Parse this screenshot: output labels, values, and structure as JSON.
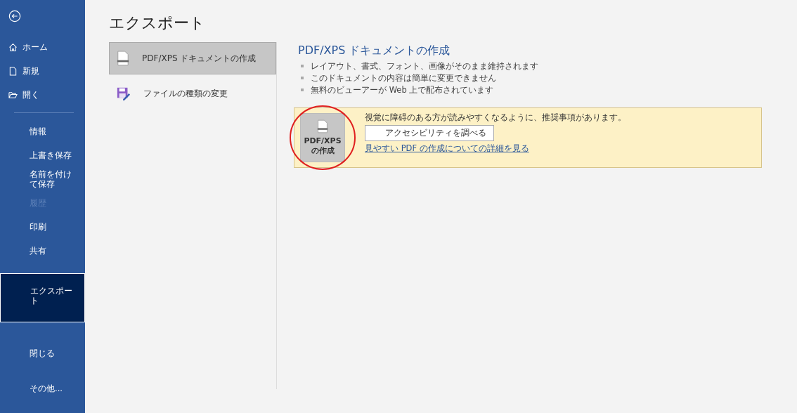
{
  "sidebar": {
    "top_items": [
      {
        "label": "ホーム"
      },
      {
        "label": "新規"
      },
      {
        "label": "開く"
      }
    ],
    "items": [
      {
        "label": "情報",
        "selected": false,
        "disabled": false
      },
      {
        "label": "上書き保存",
        "selected": false,
        "disabled": false
      },
      {
        "label": "名前を付けて保存",
        "selected": false,
        "disabled": false
      },
      {
        "label": "履歴",
        "selected": false,
        "disabled": true
      },
      {
        "label": "印刷",
        "selected": false,
        "disabled": false
      },
      {
        "label": "共有",
        "selected": false,
        "disabled": false
      },
      {
        "label": "エクスポート",
        "selected": true,
        "disabled": false
      }
    ],
    "bottom_items": [
      {
        "label": "閉じる"
      },
      {
        "label": "その他..."
      }
    ]
  },
  "page_title": "エクスポート",
  "export_options": [
    {
      "label": "PDF/XPS ドキュメントの作成",
      "selected": true
    },
    {
      "label": "ファイルの種類の変更",
      "selected": false
    }
  ],
  "detail": {
    "title": "PDF/XPS ドキュメントの作成",
    "bullets": [
      "レイアウト、書式、フォント、画像がそのまま維持されます",
      "このドキュメントの内容は簡単に変更できません",
      "無料のビューアーが Web 上で配布されています"
    ],
    "create_button": "PDF/XPS の作成",
    "notice": "視覚に障碍のある方が読みやすくなるように、推奨事項があります。",
    "check_button": "アクセシビリティを調べる",
    "link": "見やすい PDF の作成についての詳細を見る"
  }
}
